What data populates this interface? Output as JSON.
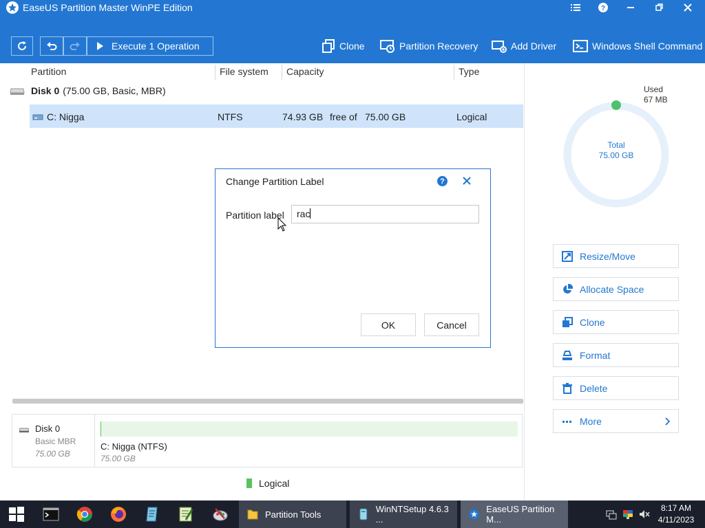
{
  "window": {
    "title": "EaseUS Partition Master WinPE Edition"
  },
  "toolbar": {
    "execute_label": "Execute 1 Operation",
    "tools": [
      "Clone",
      "Partition Recovery",
      "Add Driver",
      "Windows Shell Command"
    ]
  },
  "table": {
    "columns": [
      "Partition",
      "File system",
      "Capacity",
      "Type"
    ],
    "disk": {
      "name": "Disk 0",
      "info": "(75.00 GB, Basic, MBR)"
    },
    "partition": {
      "name": "C: Nigga",
      "filesystem": "NTFS",
      "free": "74.93 GB",
      "free_of": "free of",
      "total": "75.00 GB",
      "type": "Logical"
    }
  },
  "usage": {
    "used_label": "Used",
    "used_value": "67 MB",
    "total_label": "Total",
    "total_value": "75.00 GB",
    "accent": "#2377d2",
    "used_dot": "#4cc36a"
  },
  "operations": [
    {
      "label": "Resize/Move",
      "icon": "resize-icon"
    },
    {
      "label": "Allocate Space",
      "icon": "pie-icon"
    },
    {
      "label": "Clone",
      "icon": "clone-icon"
    },
    {
      "label": "Format",
      "icon": "format-icon"
    },
    {
      "label": "Delete",
      "icon": "trash-icon"
    },
    {
      "label": "More",
      "icon": "dots-icon"
    }
  ],
  "dialog": {
    "title": "Change Partition Label",
    "field_label": "Partition label",
    "field_value": "rac",
    "ok_label": "OK",
    "cancel_label": "Cancel"
  },
  "diskmap": {
    "disk_name": "Disk 0",
    "disk_type": "Basic MBR",
    "disk_size": "75.00 GB",
    "partition_label": "C: Nigga (NTFS)",
    "partition_size": "75.00 GB",
    "legend": "Logical"
  },
  "taskbar": {
    "tasks": [
      "Partition Tools",
      "WinNTSetup 4.6.3 ...",
      "EaseUS Partition M..."
    ],
    "time": "8:17 AM",
    "date": "4/11/2023"
  }
}
